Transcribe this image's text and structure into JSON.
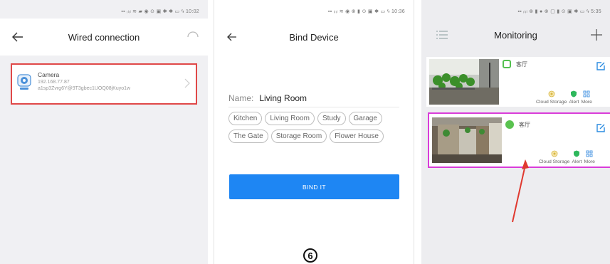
{
  "screen1": {
    "status_icons": "▪▪ ᵢₗᵢₗ ≋ ▰ ◉   ⊙ ▣ ✱ ✱ ▭ ϟ",
    "status_time": "10:02",
    "title": "Wired connection",
    "device": {
      "name": "Camera",
      "ip": "192.168.77.87",
      "uid": "a1sp3Zvrg6Y@9T3gbec1UOQ08jKuyo1w"
    }
  },
  "screen2": {
    "status_icons": "▪▪ ᵢₗᵢₗ ≋ ◉ ⊕ ▮   ⊙ ▣ ✱ ▭ ϟ",
    "status_time": "10:36",
    "title": "Bind Device",
    "name_label": "Name:",
    "name_value": "Living Room",
    "chips": [
      "Kitchen",
      "Living Room",
      "Study",
      "Garage",
      "The Gate",
      "Storage Room",
      "Flower House"
    ],
    "bind_label": "BIND IT",
    "step": "6"
  },
  "screen3": {
    "status_icons": "▪▪ ᵢₗᵢₗ ⊕ ▮ ● ⊕ ▢ ▮   ⊙ ▣ ✱ ▭ ϟ",
    "status_time": "5:35",
    "title": "Monitoring",
    "cameras": [
      {
        "name": "客厅",
        "features": [
          "Cloud Storage",
          "Alert",
          "More"
        ]
      },
      {
        "name": "客厅",
        "features": [
          "Cloud Storage",
          "Alert",
          "More"
        ]
      }
    ]
  },
  "colors": {
    "accent_blue": "#1e86f3",
    "highlight_red": "#e04848",
    "highlight_magenta": "#d93cd9",
    "online_green": "#5ac24f"
  }
}
